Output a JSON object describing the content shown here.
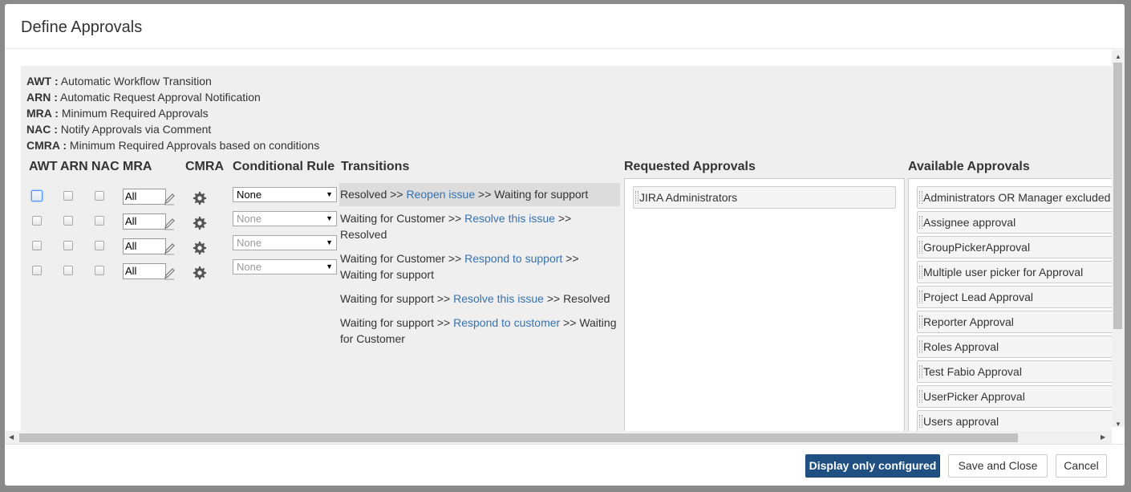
{
  "dialog": {
    "title": "Define Approvals"
  },
  "legend": [
    {
      "abbr": "AWT :",
      "text": "Automatic Workflow Transition"
    },
    {
      "abbr": "ARN :",
      "text": "Automatic Request Approval Notification"
    },
    {
      "abbr": "MRA :",
      "text": "Minimum Required Approvals"
    },
    {
      "abbr": "NAC :",
      "text": "Notify Approvals via Comment"
    },
    {
      "abbr": "CMRA :",
      "text": "Minimum Required Approvals based on conditions"
    }
  ],
  "columns": {
    "awt": "AWT",
    "arn": "ARN",
    "nac": "NAC",
    "mra": "MRA",
    "cmra": "CMRA",
    "conditional_rule": "Conditional Rule",
    "transitions": "Transitions",
    "requested": "Requested Approvals",
    "available": "Available Approvals"
  },
  "rows": [
    {
      "mra": "All",
      "rule": "None",
      "from": "Resolved >>",
      "link": "Reopen issue",
      "to": ">> Waiting for support"
    },
    {
      "mra": "All",
      "rule": "None",
      "from": "Waiting for Customer >>",
      "link": "Resolve this issue",
      "to": ">> Resolved"
    },
    {
      "mra": "All",
      "rule": "None",
      "from": "Waiting for Customer >>",
      "link": "Respond to support",
      "to": ">> Waiting for support"
    },
    {
      "mra": "All",
      "rule": "None",
      "from": "Waiting for support >>",
      "link": "Resolve this issue",
      "to": ">> Resolved"
    },
    {
      "from": "Waiting for support >>",
      "link": "Respond to customer",
      "to": ">> Waiting for Customer"
    }
  ],
  "requested_approvals": [
    "JIRA Administrators"
  ],
  "available_approvals": [
    "Administrators OR Manager excluded",
    "Assignee approval",
    "GroupPickerApproval",
    "Multiple user picker for Approval",
    "Project Lead Approval",
    "Reporter Approval",
    "Roles Approval",
    "Test Fabio Approval",
    "UserPicker Approval",
    "Users approval"
  ],
  "footer": {
    "display_configured": "Display only configured",
    "save_close": "Save and Close",
    "cancel": "Cancel"
  }
}
